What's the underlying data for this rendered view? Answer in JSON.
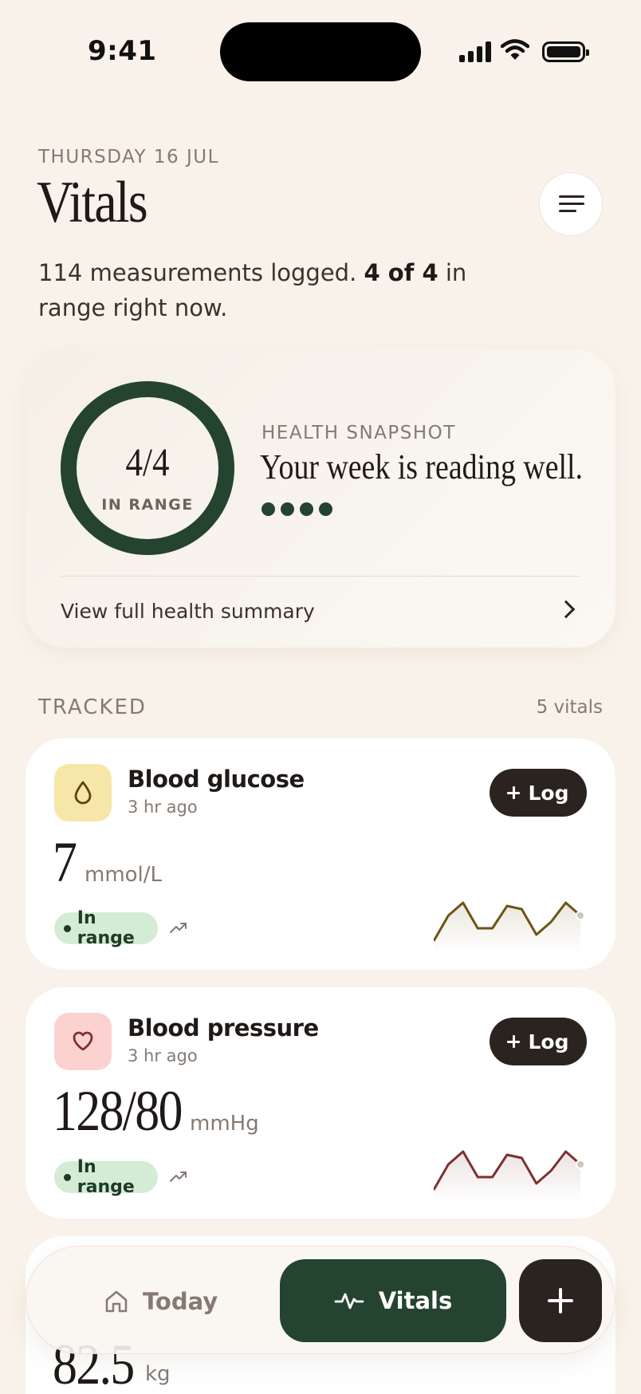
{
  "status_bar": {
    "time": "9:41"
  },
  "header": {
    "date": "THURSDAY 16 JUL",
    "title": "Vitals",
    "summary_prefix": "114 measurements logged.",
    "summary_bold": "4 of 4",
    "summary_suffix": "in range right now."
  },
  "snapshot": {
    "ring_value": "4/4",
    "ring_label": "IN RANGE",
    "ring_fraction": 1,
    "label": "HEALTH SNAPSHOT",
    "headline": "Your week is reading well.",
    "dots_count": 4,
    "link_label": "View full health summary"
  },
  "tracked": {
    "label": "TRACKED",
    "count": "5 vitals"
  },
  "vitals": [
    {
      "name": "Blood glucose",
      "time": "3 hr ago",
      "value": "7",
      "unit": "mmol/L",
      "status": "In range",
      "log_label": "Log",
      "icon": "drop-icon",
      "tile_color": "#f6e7a9",
      "spark_color": "#6e5314",
      "spark": [
        2,
        6,
        8,
        4,
        4,
        7.5,
        7,
        3,
        5,
        8,
        6
      ]
    },
    {
      "name": "Blood pressure",
      "time": "3 hr ago",
      "value": "128/80",
      "unit": "mmHg",
      "status": "In range",
      "log_label": "Log",
      "icon": "heart-icon",
      "tile_color": "#fbd2d0",
      "spark_color": "#7e3030",
      "spark": [
        2,
        6,
        8,
        4,
        4,
        7.5,
        7,
        3,
        5,
        8,
        6
      ]
    }
  ],
  "partial_vital": {
    "value": "82.5",
    "unit": "kg"
  },
  "bottom_nav": {
    "today_label": "Today",
    "vitals_label": "Vitals"
  }
}
